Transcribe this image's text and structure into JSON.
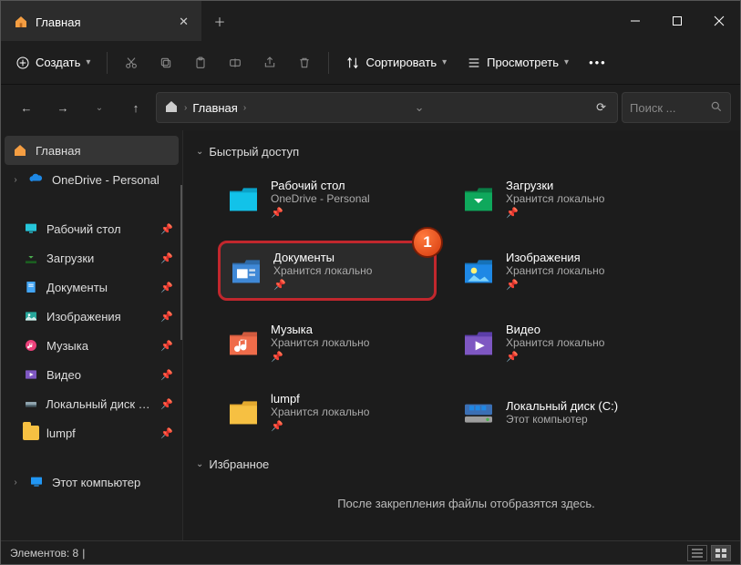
{
  "tab": {
    "title": "Главная"
  },
  "toolbar": {
    "create": "Создать",
    "sort": "Сортировать",
    "view": "Просмотреть"
  },
  "breadcrumb": {
    "home": "Главная"
  },
  "search": {
    "placeholder": "Поиск ..."
  },
  "sidebar": {
    "items": [
      {
        "label": "Главная"
      },
      {
        "label": "OneDrive - Personal"
      },
      {
        "label": "Рабочий стол"
      },
      {
        "label": "Загрузки"
      },
      {
        "label": "Документы"
      },
      {
        "label": "Изображения"
      },
      {
        "label": "Музыка"
      },
      {
        "label": "Видео"
      },
      {
        "label": "Локальный диск (C:)"
      },
      {
        "label": "lumpf"
      },
      {
        "label": "Этот компьютер"
      }
    ]
  },
  "sections": {
    "quick": "Быстрый доступ",
    "fav": "Избранное"
  },
  "quick": [
    {
      "title": "Рабочий стол",
      "sub": "OneDrive - Personal",
      "pin": true
    },
    {
      "title": "Загрузки",
      "sub": "Хранится локально",
      "pin": true
    },
    {
      "title": "Документы",
      "sub": "Хранится локально",
      "pin": true
    },
    {
      "title": "Изображения",
      "sub": "Хранится локально",
      "pin": true
    },
    {
      "title": "Музыка",
      "sub": "Хранится локально",
      "pin": true
    },
    {
      "title": "Видео",
      "sub": "Хранится локально",
      "pin": true
    },
    {
      "title": "lumpf",
      "sub": "Хранится локально",
      "pin": true
    },
    {
      "title": "Локальный диск (C:)",
      "sub": "Этот компьютер",
      "pin": false
    }
  ],
  "favtext": "После закрепления файлы отобразятся здесь.",
  "status": {
    "count_label": "Элементов:",
    "count": "8"
  },
  "annotation": {
    "marker": "1"
  }
}
